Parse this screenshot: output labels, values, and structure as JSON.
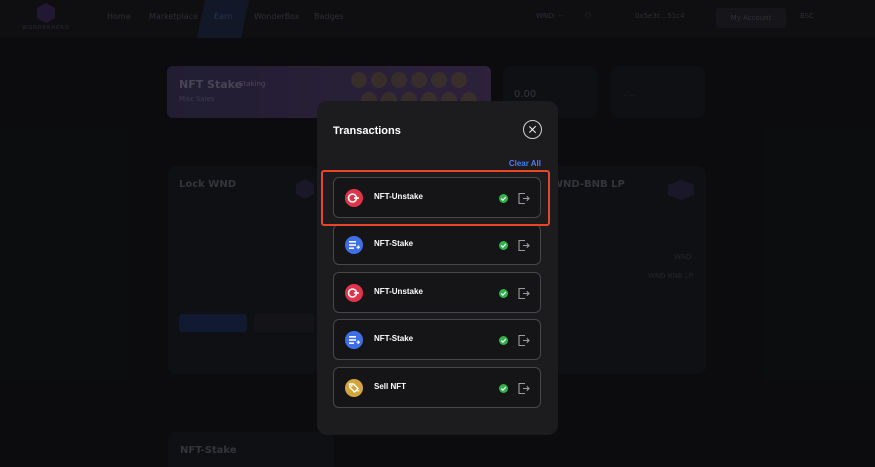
{
  "nav": {
    "logo_text": "WONDERHERO",
    "items": [
      "Home",
      "Marketplace",
      "Earn",
      "WonderBox",
      "Badges"
    ],
    "balance": "WND: --",
    "address": "0x5e3c...51c4",
    "my_account": "My Account",
    "network": "BSC"
  },
  "background": {
    "banner_title": "NFT Stake",
    "banner_badge": "Staking",
    "banner_sub": "Max Sales",
    "stat_value": "0.00",
    "stat_dash": "-- --",
    "lock_title": "Lock WND",
    "lp_title": "WND-BNB LP",
    "nft_stake_title": "NFT-Stake",
    "wnd_unit": "WND",
    "lp_unit": "WND-BNB LP"
  },
  "modal": {
    "title": "Transactions",
    "clear_all": "Clear All",
    "transactions": [
      {
        "label": "NFT-Unstake",
        "icon": "unstake-icon",
        "status": "success"
      },
      {
        "label": "NFT-Stake",
        "icon": "stake-icon",
        "status": "success"
      },
      {
        "label": "NFT-Unstake",
        "icon": "unstake-icon",
        "status": "success"
      },
      {
        "label": "NFT-Stake",
        "icon": "stake-icon",
        "status": "success"
      },
      {
        "label": "Sell NFT",
        "icon": "sell-nft-icon",
        "status": "success"
      }
    ]
  },
  "colors": {
    "unstake": "#e0344a",
    "stake": "#3f6fe8",
    "sell": "#d4a43a",
    "success": "#2fb24c",
    "link": "#4a7cf0",
    "highlight": "#e8462a"
  }
}
